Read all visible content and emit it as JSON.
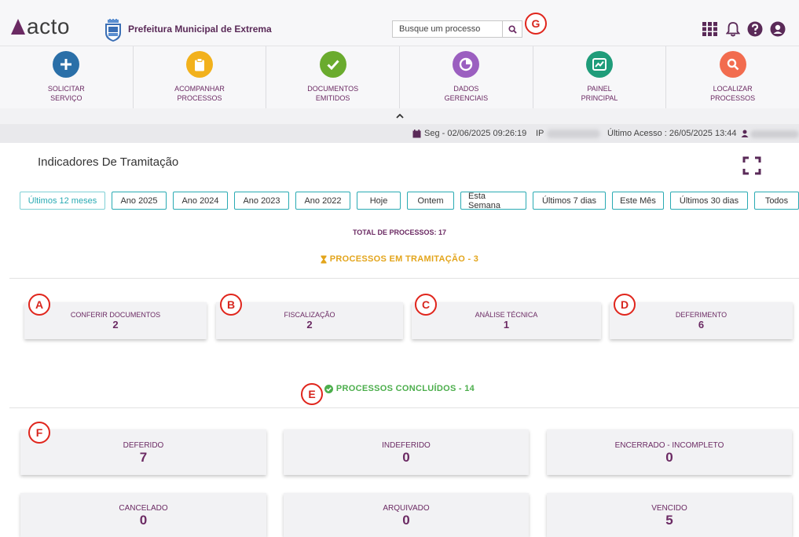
{
  "header": {
    "logo_text": "acto",
    "org_name": "Prefeitura Municipal de Extrema",
    "search_placeholder": "Busque um processo",
    "icons": [
      "grid-icon",
      "bell-icon",
      "help-icon",
      "user-circle-icon"
    ]
  },
  "markers": {
    "a": "A",
    "b": "B",
    "c": "C",
    "d": "D",
    "e": "E",
    "f": "F",
    "g": "G"
  },
  "nav": [
    {
      "line1": "SOLICITAR",
      "line2": "SERVIÇO",
      "color": "#2a6fa8",
      "icon": "plus-icon"
    },
    {
      "line1": "ACOMPANHAR",
      "line2": "PROCESSOS",
      "color": "#f2b11c",
      "icon": "clipboard-icon"
    },
    {
      "line1": "DOCUMENTOS",
      "line2": "EMITIDOS",
      "color": "#6aab2e",
      "icon": "check-icon"
    },
    {
      "line1": "DADOS",
      "line2": "GERENCIAIS",
      "color": "#9b5fc0",
      "icon": "pie-chart-icon"
    },
    {
      "line1": "PAINEL",
      "line2": "PRINCIPAL",
      "color": "#1f9c7a",
      "icon": "line-chart-icon"
    },
    {
      "line1": "LOCALIZAR",
      "line2": "PROCESSOS",
      "color": "#f26c4f",
      "icon": "search-icon"
    }
  ],
  "info_bar": {
    "date": "Seg - 02/06/2025 09:26:19",
    "ip_label": "IP",
    "last_access": "Último Acesso : 26/05/2025 13:44"
  },
  "page_title": "Indicadores De Tramitação",
  "filters": [
    {
      "label": "Últimos 12 meses",
      "active": true
    },
    {
      "label": "Ano 2025"
    },
    {
      "label": "Ano 2024"
    },
    {
      "label": "Ano 2023"
    },
    {
      "label": "Ano 2022"
    },
    {
      "label": "Hoje"
    },
    {
      "label": "Ontem"
    },
    {
      "label": "Esta Semana"
    },
    {
      "label": "Últimos 7 dias"
    },
    {
      "label": "Este Mês"
    },
    {
      "label": "Últimos 30 dias"
    },
    {
      "label": "Todos"
    }
  ],
  "total": {
    "label": "TOTAL DE PROCESSOS:",
    "value": "17"
  },
  "tramitacao": {
    "title": "PROCESSOS EM TRAMITAÇÃO - 3",
    "color": "#e3a51c",
    "cards": [
      {
        "label": "CONFERIR DOCUMENTOS",
        "value": "2"
      },
      {
        "label": "FISCALIZAÇÃO",
        "value": "2"
      },
      {
        "label": "ANÁLISE TÉCNICA",
        "value": "1"
      },
      {
        "label": "DEFERIMENTO",
        "value": "6"
      }
    ]
  },
  "concluidos": {
    "title": "PROCESSOS CONCLUÍDOS - 14",
    "color": "#4cae4c",
    "cards": [
      {
        "label": "DEFERIDO",
        "value": "7"
      },
      {
        "label": "INDEFERIDO",
        "value": "0"
      },
      {
        "label": "ENCERRADO - INCOMPLETO",
        "value": "0"
      },
      {
        "label": "CANCELADO",
        "value": "0"
      },
      {
        "label": "ARQUIVADO",
        "value": "0"
      },
      {
        "label": "VENCIDO",
        "value": "5"
      }
    ]
  }
}
